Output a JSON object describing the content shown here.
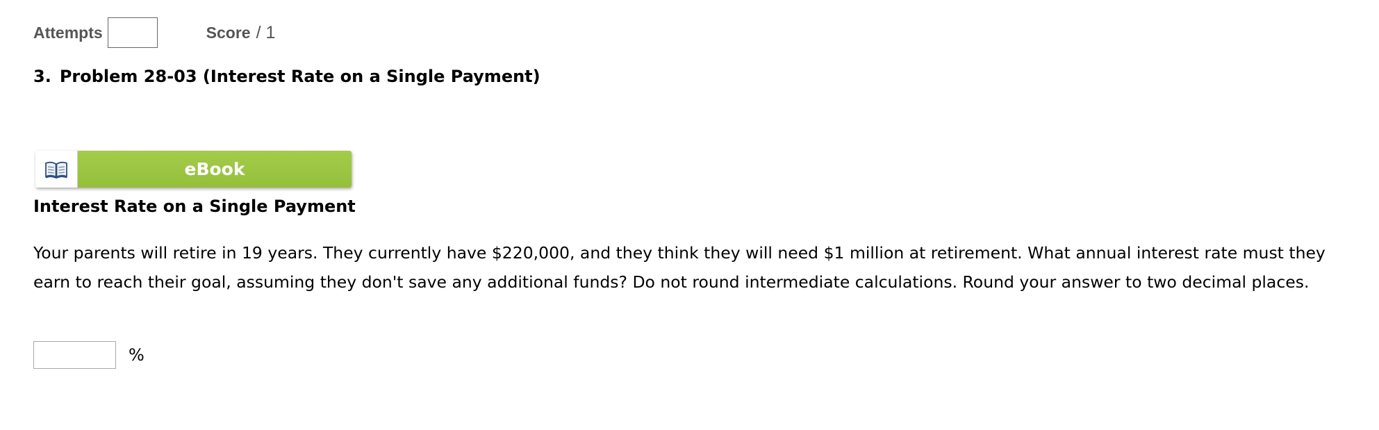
{
  "header": {
    "attempts_label": "Attempts",
    "attempts_value": "",
    "score_label": "Score",
    "score_separator": "/ 1"
  },
  "problem": {
    "number": "3.",
    "title": "Problem 28-03 (Interest Rate on a Single Payment)"
  },
  "ebook": {
    "icon": "open-book-icon",
    "label": "eBook",
    "accent_color": "#9bc441"
  },
  "content": {
    "subheading": "Interest Rate on a Single Payment",
    "question": "Your parents will retire in 19 years. They currently have $220,000, and they think they will need $1 million at retirement. What annual interest rate must they earn to reach their goal, assuming they don't save any additional funds? Do not round intermediate calculations. Round your answer to two decimal places."
  },
  "answer": {
    "value": "",
    "unit": "%"
  }
}
